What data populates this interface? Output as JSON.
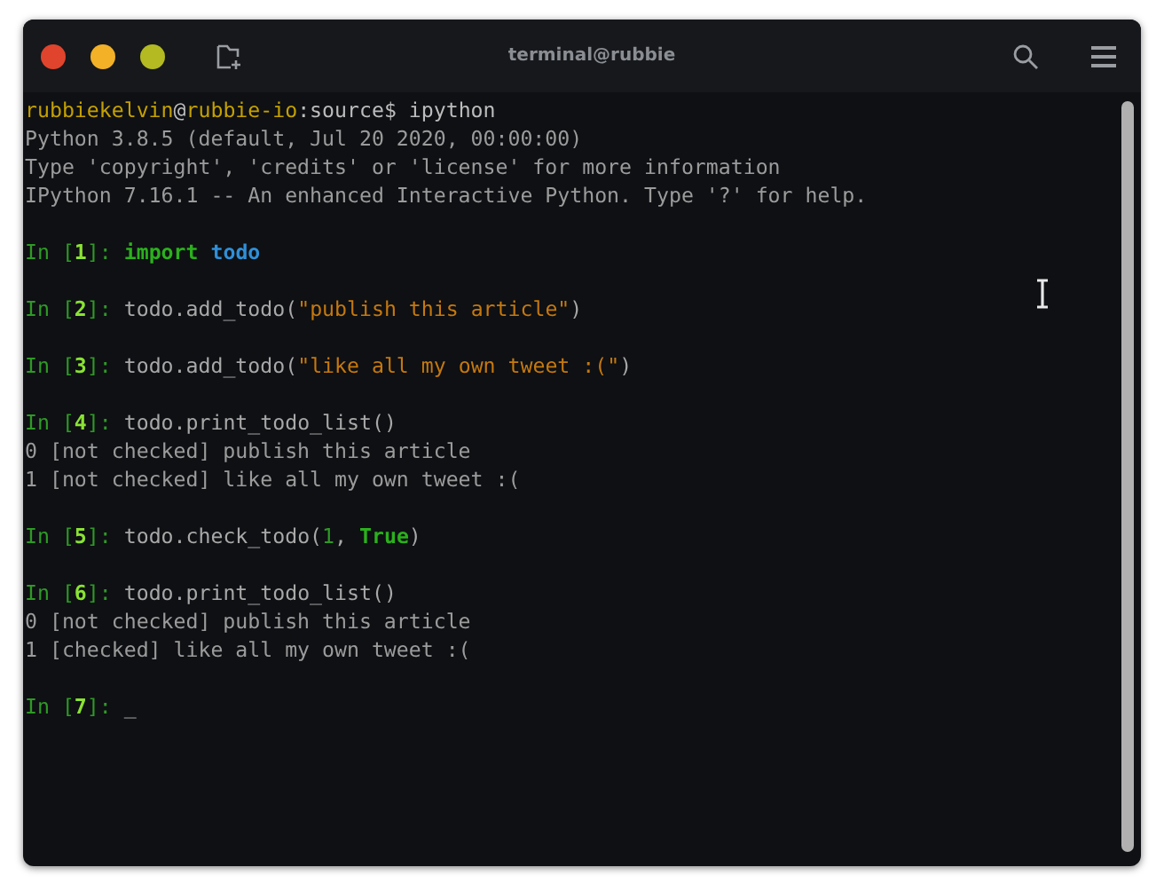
{
  "window": {
    "title": "terminal@rubbie"
  },
  "lines": [
    {
      "kind": "text",
      "segments": [
        {
          "kind": "user",
          "text": "rubbiekelvin"
        },
        {
          "kind": "plain",
          "text": "@"
        },
        {
          "kind": "user",
          "text": "rubbie-io"
        },
        {
          "kind": "plain",
          "text": ":source$ ipython"
        }
      ]
    },
    {
      "kind": "text",
      "segments": [
        {
          "kind": "output",
          "text": "Python 3.8.5 (default, Jul 20 2020, 00:00:00)"
        }
      ]
    },
    {
      "kind": "text",
      "segments": [
        {
          "kind": "output",
          "text": "Type 'copyright', 'credits' or 'license' for more information"
        }
      ]
    },
    {
      "kind": "text",
      "segments": [
        {
          "kind": "output",
          "text": "IPython 7.16.1 -- An enhanced Interactive Python. Type '?' for help."
        }
      ]
    },
    {
      "kind": "blank"
    },
    {
      "kind": "text",
      "segments": [
        {
          "kind": "prompt",
          "text": "In ["
        },
        {
          "kind": "num",
          "text": "1"
        },
        {
          "kind": "prompt",
          "text": "]: "
        },
        {
          "kind": "keyword",
          "text": "import "
        },
        {
          "kind": "module",
          "text": "todo"
        }
      ]
    },
    {
      "kind": "blank"
    },
    {
      "kind": "text",
      "segments": [
        {
          "kind": "prompt",
          "text": "In ["
        },
        {
          "kind": "num",
          "text": "2"
        },
        {
          "kind": "prompt",
          "text": "]: "
        },
        {
          "kind": "code",
          "text": "todo.add_todo("
        },
        {
          "kind": "string",
          "text": "\"publish this article\""
        },
        {
          "kind": "code",
          "text": ")"
        }
      ]
    },
    {
      "kind": "blank"
    },
    {
      "kind": "text",
      "segments": [
        {
          "kind": "prompt",
          "text": "In ["
        },
        {
          "kind": "num",
          "text": "3"
        },
        {
          "kind": "prompt",
          "text": "]: "
        },
        {
          "kind": "code",
          "text": "todo.add_todo("
        },
        {
          "kind": "string",
          "text": "\"like all my own tweet :(\""
        },
        {
          "kind": "code",
          "text": ")"
        }
      ]
    },
    {
      "kind": "blank"
    },
    {
      "kind": "text",
      "segments": [
        {
          "kind": "prompt",
          "text": "In ["
        },
        {
          "kind": "num",
          "text": "4"
        },
        {
          "kind": "prompt",
          "text": "]: "
        },
        {
          "kind": "code",
          "text": "todo.print_todo_list()"
        }
      ]
    },
    {
      "kind": "text",
      "segments": [
        {
          "kind": "output",
          "text": "0 [not checked] publish this article"
        }
      ]
    },
    {
      "kind": "text",
      "segments": [
        {
          "kind": "output",
          "text": "1 [not checked] like all my own tweet :("
        }
      ]
    },
    {
      "kind": "blank"
    },
    {
      "kind": "text",
      "segments": [
        {
          "kind": "prompt",
          "text": "In ["
        },
        {
          "kind": "num",
          "text": "5"
        },
        {
          "kind": "prompt",
          "text": "]: "
        },
        {
          "kind": "code",
          "text": "todo.check_todo("
        },
        {
          "kind": "literal",
          "text": "1"
        },
        {
          "kind": "code",
          "text": ", "
        },
        {
          "kind": "keyword",
          "text": "True"
        },
        {
          "kind": "code",
          "text": ")"
        }
      ]
    },
    {
      "kind": "blank"
    },
    {
      "kind": "text",
      "segments": [
        {
          "kind": "prompt",
          "text": "In ["
        },
        {
          "kind": "num",
          "text": "6"
        },
        {
          "kind": "prompt",
          "text": "]: "
        },
        {
          "kind": "code",
          "text": "todo.print_todo_list()"
        }
      ]
    },
    {
      "kind": "text",
      "segments": [
        {
          "kind": "output",
          "text": "0 [not checked] publish this article"
        }
      ]
    },
    {
      "kind": "text",
      "segments": [
        {
          "kind": "output",
          "text": "1 [checked] like all my own tweet :("
        }
      ]
    },
    {
      "kind": "blank"
    },
    {
      "kind": "text",
      "segments": [
        {
          "kind": "prompt",
          "text": "In ["
        },
        {
          "kind": "num",
          "text": "7"
        },
        {
          "kind": "prompt",
          "text": "]: "
        },
        {
          "kind": "code",
          "text": "_"
        }
      ]
    }
  ]
}
